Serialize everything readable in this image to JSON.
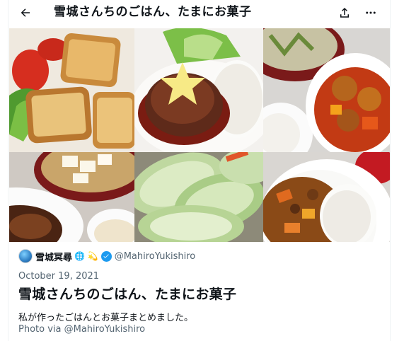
{
  "header": {
    "title": "雪城さんちのごはん、たまにお菓子"
  },
  "gallery": {
    "tiles": [
      {
        "icon": "french-toast-salad"
      },
      {
        "icon": "hamburg-steak-rice"
      },
      {
        "icon": "soup-sweet-sour-pork"
      },
      {
        "icon": "tofu-soup-stirfry"
      },
      {
        "icon": "cabbage-rolls"
      },
      {
        "icon": "curry-rice"
      }
    ]
  },
  "author": {
    "name": "雪城冥尋",
    "emojis": "🌐 💫",
    "handle": "@MahiroYukishiro",
    "verified_color": "#1d9bf0"
  },
  "post": {
    "date": "October 19, 2021",
    "heading": "雪城さんちのごはん、たまにお菓子",
    "description": "私が作ったごはんとお菓子まとめました。",
    "photo_credit": "Photo via @MahiroYukishiro"
  },
  "colors": {
    "text": "#0f1419",
    "muted": "#536471",
    "accent": "#1d9bf0"
  }
}
